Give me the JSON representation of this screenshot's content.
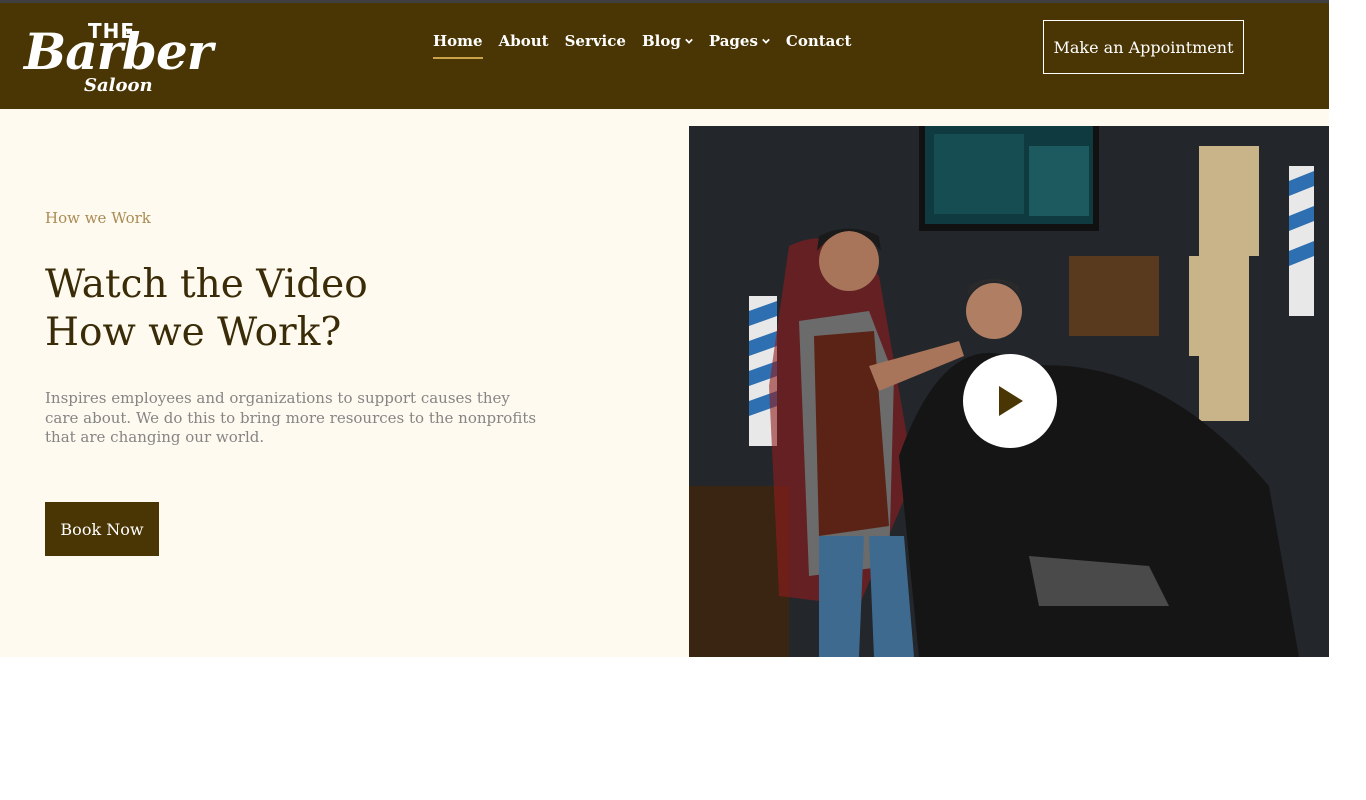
{
  "brand": {
    "top": "THE",
    "main": "Barber",
    "sub": "Saloon"
  },
  "nav": [
    {
      "label": "Home",
      "active": true,
      "dropdown": false
    },
    {
      "label": "About",
      "active": false,
      "dropdown": false
    },
    {
      "label": "Service",
      "active": false,
      "dropdown": false
    },
    {
      "label": "Blog",
      "active": false,
      "dropdown": true
    },
    {
      "label": "Pages",
      "active": false,
      "dropdown": true
    },
    {
      "label": "Contact",
      "active": false,
      "dropdown": false
    }
  ],
  "cta": {
    "label": "Make an Appointment"
  },
  "hero": {
    "eyebrow": "How we Work",
    "title_line1": "Watch the Video",
    "title_line2": "How we Work?",
    "description": "Inspires employees and organizations to support causes they care about. We do this to bring more resources to the nonprofits that are changing our world.",
    "button": "Book Now"
  },
  "video": {
    "play_icon": "play-icon"
  },
  "colors": {
    "brand": "#4a3605",
    "accent": "#c9a24a",
    "hero_bg": "#fffaef",
    "eyebrow": "#a98c55",
    "heading": "#3a2c08",
    "body_text": "#858585"
  }
}
